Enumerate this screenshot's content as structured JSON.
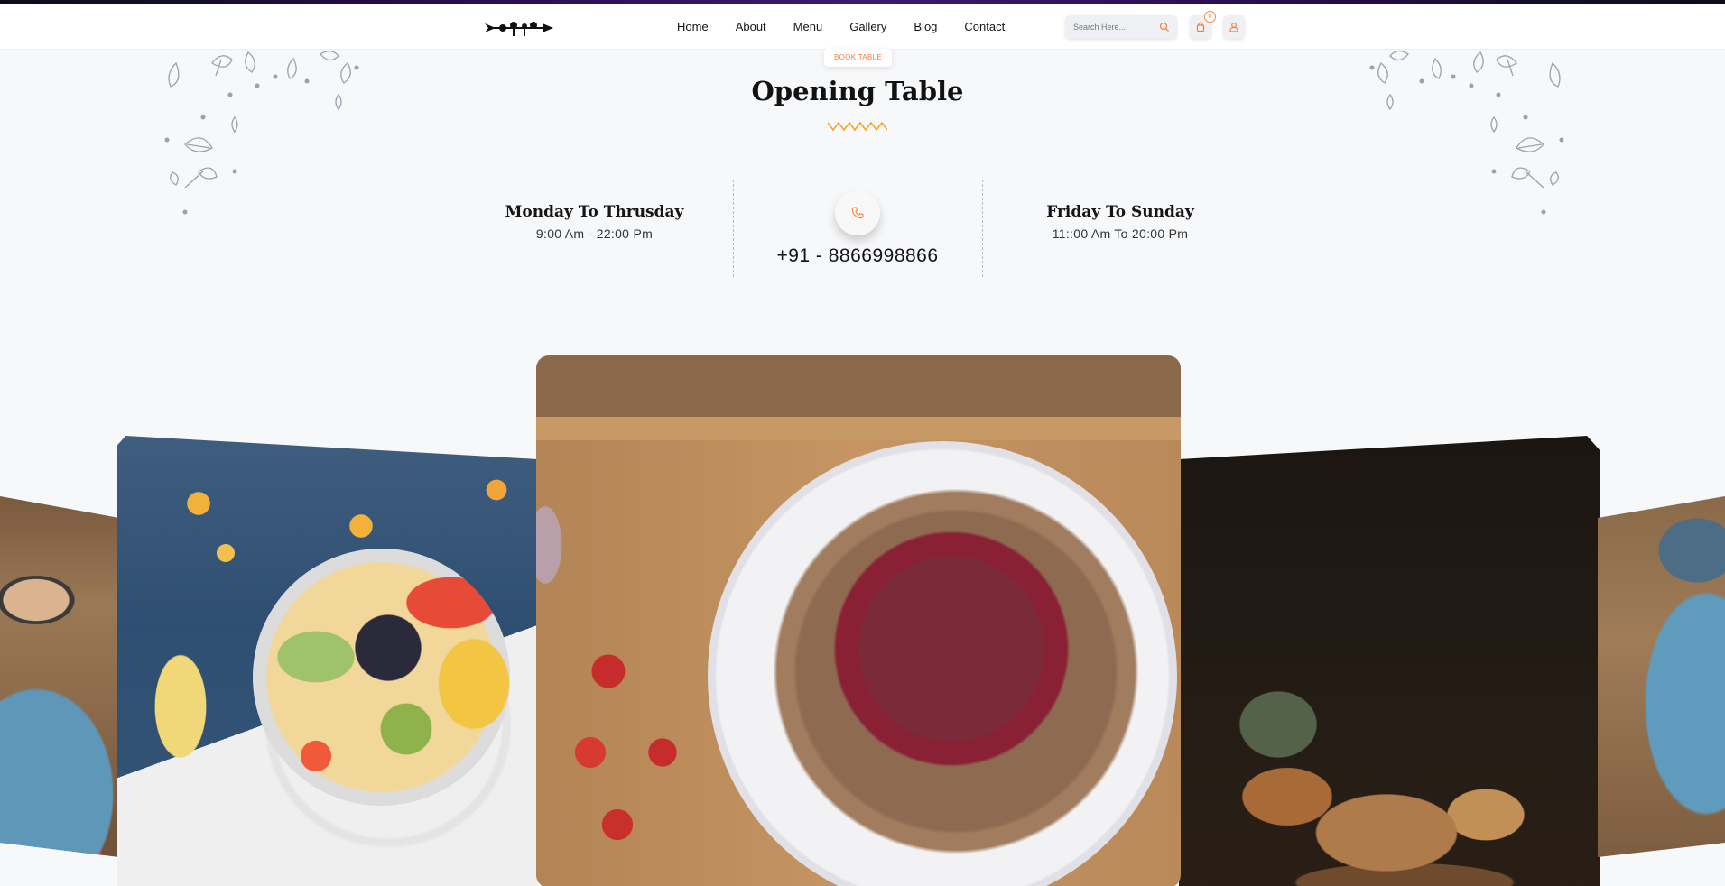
{
  "nav": {
    "logo_icon": "fork-knife-logo",
    "links": [
      {
        "label": "Home"
      },
      {
        "label": "About"
      },
      {
        "label": "Menu"
      },
      {
        "label": "Gallery"
      },
      {
        "label": "Blog"
      },
      {
        "label": "Contact"
      }
    ],
    "search_placeholder": "Search Here...",
    "cart_count": "0",
    "icons": [
      "search-icon",
      "cart-icon",
      "user-icon"
    ]
  },
  "section": {
    "tag": "BOOK TABLE",
    "title": "Opening Table",
    "weekday": {
      "title": "Monday To Thrusday",
      "hours": "9:00 Am - 22:00 Pm"
    },
    "weekend": {
      "title": "Friday To Sunday",
      "hours": "11::00 Am To 20:00 Pm"
    },
    "phone": "+91 - 8866998866",
    "phone_icon": "phone-icon"
  },
  "colors": {
    "accent": "#f0803c",
    "zigzag": "#f3a31b",
    "dark": "#121212",
    "background": "#f7f8fa"
  },
  "gallery": {
    "images": [
      "fruit-bowl-photo",
      "berry-pancakes-photo",
      "bread-and-cheese-photo"
    ]
  }
}
